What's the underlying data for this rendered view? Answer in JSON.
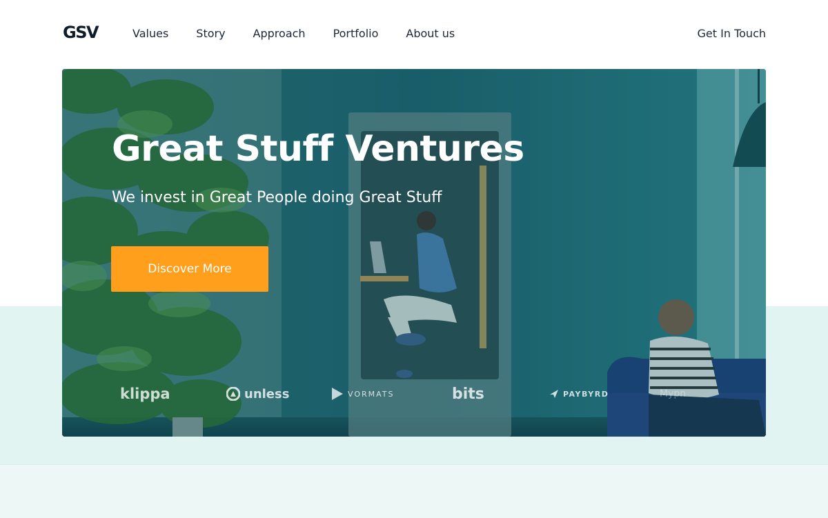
{
  "header": {
    "logo": "GSV",
    "nav": [
      {
        "label": "Values"
      },
      {
        "label": "Story"
      },
      {
        "label": "Approach"
      },
      {
        "label": "Portfolio"
      },
      {
        "label": "About us"
      }
    ],
    "cta": "Get In Touch"
  },
  "hero": {
    "title": "Great Stuff Ventures",
    "subtitle": "We invest in Great People doing Great Stuff",
    "button": "Discover More",
    "background_description": "office photo with teal tint: plant, phone booth with woman on laptop, man on blue sofa"
  },
  "portfolio_logos": [
    {
      "name": "klippa",
      "text": "klippa"
    },
    {
      "name": "unless",
      "text": "unless"
    },
    {
      "name": "vormats",
      "text": "VORMATS"
    },
    {
      "name": "bits",
      "text": "bits"
    },
    {
      "name": "paybyrd",
      "text": "PAYBYRD"
    },
    {
      "name": "sixth-logo",
      "text": "Mypn"
    }
  ],
  "colors": {
    "accent_button": "#ff9f1c",
    "hero_tint": "#1f6f78",
    "mint_band": "#e1f4f2",
    "text_dark": "#1c2733"
  }
}
